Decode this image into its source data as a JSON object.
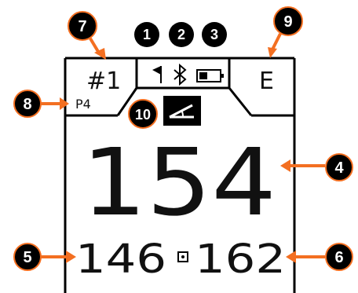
{
  "device": {
    "hole_label": "#1",
    "par_label": "P4",
    "wind_indicator": "E",
    "distance_center": "154",
    "distance_front": "146",
    "distance_back": "162",
    "status_icons": [
      "flag-icon",
      "bluetooth-icon",
      "battery-icon"
    ],
    "mode_icon": "slope-icon"
  },
  "callouts": {
    "c1": "1",
    "c2": "2",
    "c3": "3",
    "c4": "4",
    "c5": "5",
    "c6": "6",
    "c7": "7",
    "c8": "8",
    "c9": "9",
    "c10": "10"
  },
  "colors": {
    "callout_arrow": "#f36f21",
    "callout_circle": "#000000",
    "screen_text": "#111111",
    "screen_border": "#000000",
    "background": "#ffffff"
  }
}
